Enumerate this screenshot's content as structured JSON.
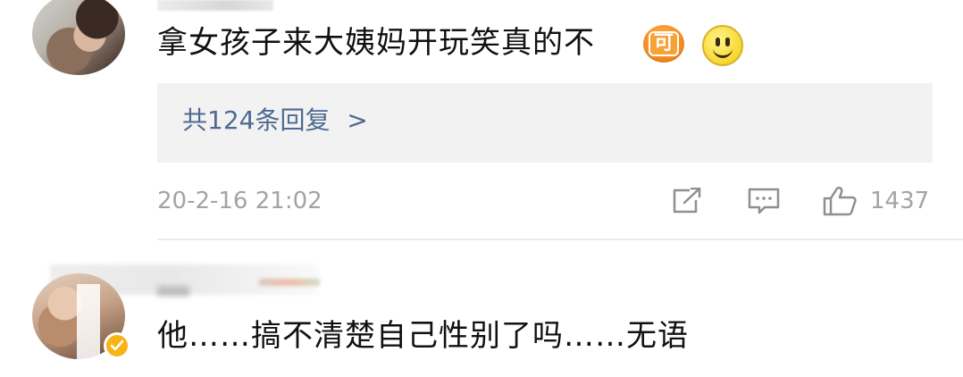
{
  "comments": [
    {
      "text": "拿女孩子来大姨妈开玩笑真的不",
      "emoji_ke_text": "可",
      "emoji_smile": "smile-emoji",
      "replies_label": "共124条回复",
      "replies_chevron": ">",
      "timestamp": "20-2-16 21:02",
      "like_count": "1437"
    },
    {
      "text": "他……搞不清楚自己性别了吗……无语",
      "verified": true
    }
  ],
  "colors": {
    "link": "#4e6a92",
    "meta_gray": "#a3a3a3",
    "reply_box_bg": "#f2f2f2",
    "verified_badge": "#f7b414",
    "emoji_orange": "#f2861a"
  },
  "icons": {
    "share": "share-icon",
    "comment": "comment-icon",
    "like": "thumbs-up-icon",
    "verified": "verified-badge-icon"
  }
}
